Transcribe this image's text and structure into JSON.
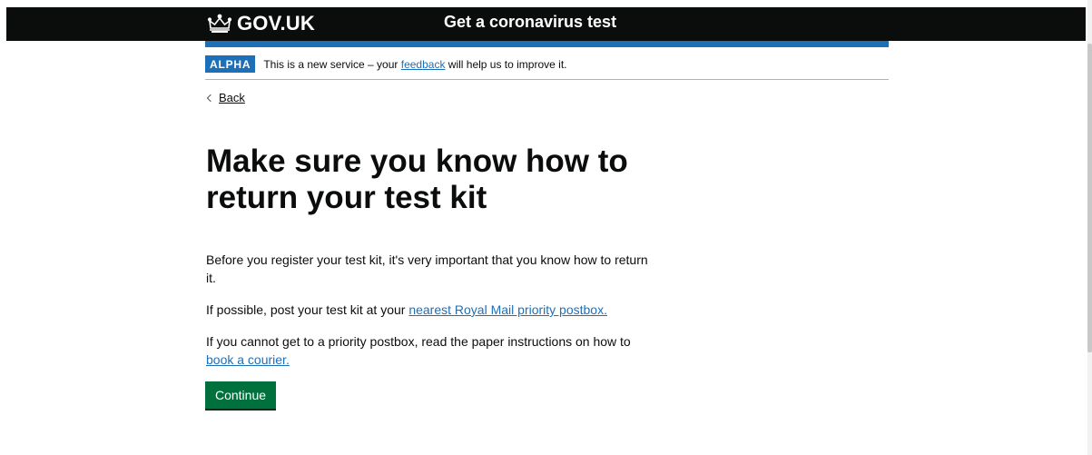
{
  "header": {
    "logo_text": "GOV.UK",
    "logo_icon": "crown-icon",
    "service_name": "Get a coronavirus test"
  },
  "phase_banner": {
    "tag": "ALPHA",
    "text_before": "This is a new service – your ",
    "link_text": "feedback",
    "text_after": " will help us to improve it."
  },
  "back_link": {
    "icon": "chevron-left-icon",
    "label": "Back"
  },
  "main": {
    "title": "Make sure you know how to return your test kit",
    "paragraph1": "Before you register your test kit, it's very important that you know how to return it.",
    "paragraph2_before": "If possible, post your test kit at your ",
    "paragraph2_link": "nearest Royal Mail priority postbox.",
    "paragraph3_before": "If you cannot get to a priority postbox, read the paper instructions on how to ",
    "paragraph3_link": "book a courier.",
    "continue_label": "Continue"
  },
  "colors": {
    "header_bg": "#0b0c0c",
    "brand_blue": "#1d70b8",
    "button_green": "#00703c",
    "text": "#0b0c0c"
  }
}
